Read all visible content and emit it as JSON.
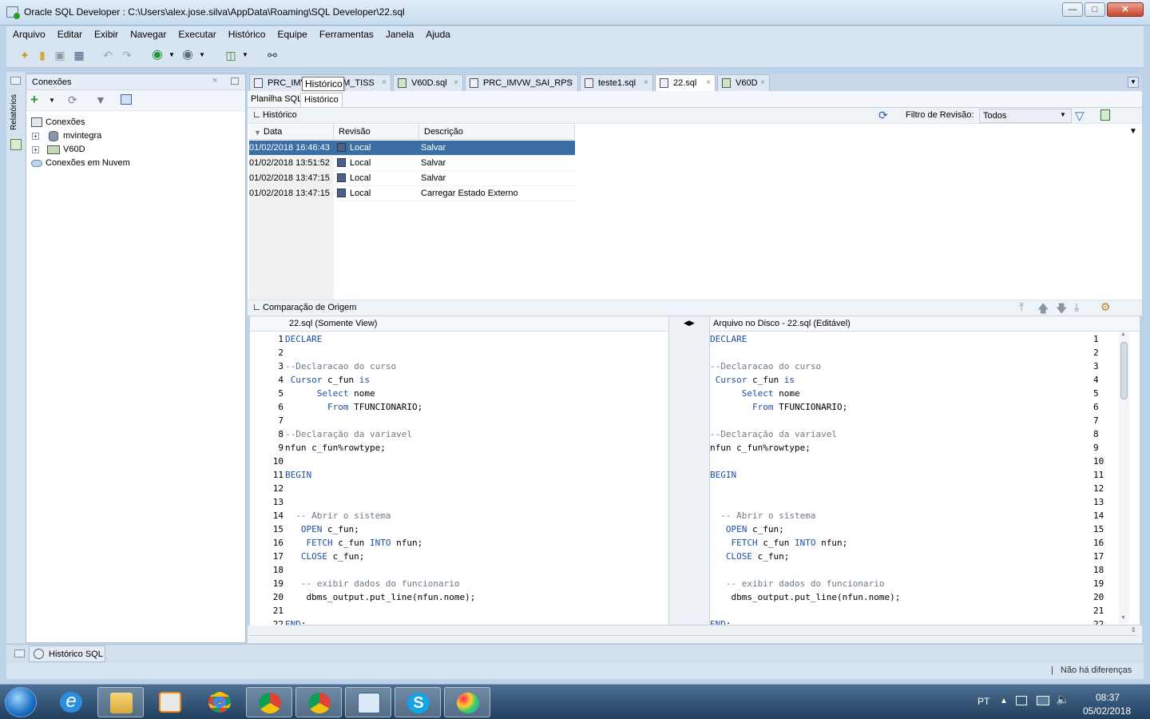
{
  "window": {
    "title": "Oracle SQL Developer : C:\\Users\\alex.jose.silva\\AppData\\Roaming\\SQL Developer\\22.sql"
  },
  "menu": [
    "Arquivo",
    "Editar",
    "Exibir",
    "Navegar",
    "Executar",
    "Histórico",
    "Equipe",
    "Ferramentas",
    "Janela",
    "Ajuda"
  ],
  "leftstrip": {
    "label": "Relatórios"
  },
  "connections": {
    "panel_title": "Conexões",
    "tree": [
      {
        "label": "Conexões"
      },
      {
        "label": "mvintegra"
      },
      {
        "label": "V60D"
      },
      {
        "label": "Conexões em Nuvem"
      }
    ]
  },
  "doc_tabs": [
    "PRC_IMVW_RPS_M_TISS",
    "V60D.sql",
    "PRC_IMVW_SAI_RPS",
    "teste1.sql",
    "22.sql",
    "V60D"
  ],
  "tooltip": "Histórico",
  "sub_tabs": [
    "Planilha SQL",
    "Histórico"
  ],
  "history": {
    "section_title": "Histórico",
    "filter_label": "Filtro de Revisão:",
    "filter_value": "Todos",
    "columns": [
      "Data",
      "Revisão",
      "Descrição"
    ],
    "rows": [
      {
        "date": "01/02/2018 16:46:43",
        "revision": "Local",
        "description": "Salvar"
      },
      {
        "date": "01/02/2018 13:51:52",
        "revision": "Local",
        "description": "Salvar"
      },
      {
        "date": "01/02/2018 13:47:15",
        "revision": "Local",
        "description": "Salvar"
      },
      {
        "date": "01/02/2018 13:47:15",
        "revision": "Local",
        "description": "Carregar Estado Externo"
      }
    ]
  },
  "compare": {
    "section_title": "Comparação de Origem",
    "left_title": "22.sql (Somente View)",
    "right_title": "Arquivo no Disco - 22.sql (Editável)",
    "lines": [
      "DECLARE",
      "",
      "--Declaracao do curso",
      " Cursor c_fun is",
      "      Select nome",
      "        From TFUNCIONARIO;",
      "",
      "--Declaração da variavel",
      "nfun c_fun%rowtype;",
      "",
      "BEGIN",
      "",
      "",
      "  -- Abrir o sistema",
      "   OPEN c_fun;",
      "    FETCH c_fun INTO nfun;",
      "   CLOSE c_fun;",
      "",
      "   -- exibir dados do funcionario",
      "    dbms_output.put_line(nfun.nome);",
      "",
      "END;"
    ]
  },
  "bottom_tab": "Histórico SQL",
  "status": "Não há diferenças",
  "taskbar": {
    "lang": "PT",
    "time": "08:37",
    "date": "05/02/2018"
  }
}
